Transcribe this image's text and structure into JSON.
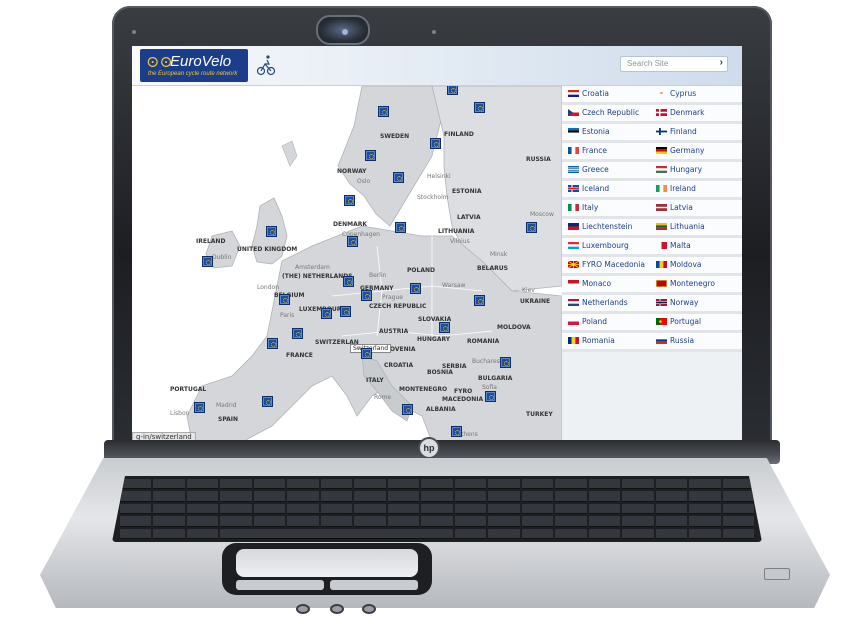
{
  "header": {
    "logo_text": "EuroVelo",
    "logo_tagline": "the European cycle route network",
    "search_placeholder": "Search Site",
    "search_arrow": "›"
  },
  "map": {
    "labels": [
      {
        "text": "SWEDEN"
      },
      {
        "text": "FINLAND"
      },
      {
        "text": "RUSSIA"
      },
      {
        "text": "NORWAY"
      },
      {
        "text": "Oslo"
      },
      {
        "text": "Helsinki"
      },
      {
        "text": "Stockholm"
      },
      {
        "text": "ESTONIA"
      },
      {
        "text": "Moscow"
      },
      {
        "text": "LATVIA"
      },
      {
        "text": "DENMARK"
      },
      {
        "text": "Copenhagen"
      },
      {
        "text": "LITHUANIA"
      },
      {
        "text": "Vilnius"
      },
      {
        "text": "Minsk"
      },
      {
        "text": "IRELAND"
      },
      {
        "text": "UNITED KINGDOM"
      },
      {
        "text": "Dublin"
      },
      {
        "text": "Amsterdam"
      },
      {
        "text": "(THE) NETHERLANDS"
      },
      {
        "text": "Berlin"
      },
      {
        "text": "POLAND"
      },
      {
        "text": "BELARUS"
      },
      {
        "text": "London"
      },
      {
        "text": "BELGIUM"
      },
      {
        "text": "GERMANY"
      },
      {
        "text": "Warsaw"
      },
      {
        "text": "Kiev"
      },
      {
        "text": "UKRAINE"
      },
      {
        "text": "LUXEMBOURG"
      },
      {
        "text": "Prague"
      },
      {
        "text": "CZECH REPUBLIC"
      },
      {
        "text": "Paris"
      },
      {
        "text": "SLOVAKIA"
      },
      {
        "text": "AUSTRIA"
      },
      {
        "text": "MOLDOVA"
      },
      {
        "text": "HUNGARY"
      },
      {
        "text": "SWITZERLAN"
      },
      {
        "text": "SLOVENIA"
      },
      {
        "text": "ROMANIA"
      },
      {
        "text": "FRANCE"
      },
      {
        "text": "CROATIA"
      },
      {
        "text": "Bucharest"
      },
      {
        "text": "BOSNIA"
      },
      {
        "text": "SERBIA"
      },
      {
        "text": "ITALY"
      },
      {
        "text": "BULGARIA"
      },
      {
        "text": "MONTENEGRO"
      },
      {
        "text": "Sofia"
      },
      {
        "text": "FYRO"
      },
      {
        "text": "MACEDONIA"
      },
      {
        "text": "PORTUGAL"
      },
      {
        "text": "Madrid"
      },
      {
        "text": "Rome"
      },
      {
        "text": "ALBANIA"
      },
      {
        "text": "Lisbon"
      },
      {
        "text": "SPAIN"
      },
      {
        "text": "TURKEY"
      },
      {
        "text": "Athens"
      }
    ],
    "tooltip": "Switzerland",
    "status_url": "g-in/switzerland"
  },
  "countries": [
    [
      "Croatia",
      "Cyprus"
    ],
    [
      "Czech Republic",
      "Denmark"
    ],
    [
      "Estonia",
      "Finland"
    ],
    [
      "France",
      "Germany"
    ],
    [
      "Greece",
      "Hungary"
    ],
    [
      "Iceland",
      "Ireland"
    ],
    [
      "Italy",
      "Latvia"
    ],
    [
      "Liechtenstein",
      "Lithuania"
    ],
    [
      "Luxembourg",
      "Malta"
    ],
    [
      "FYRO Macedonia",
      "Moldova"
    ],
    [
      "Monaco",
      "Montenegro"
    ],
    [
      "Netherlands",
      "Norway"
    ],
    [
      "Poland",
      "Portugal"
    ],
    [
      "Romania",
      "Russia"
    ]
  ],
  "colors": {
    "brand_blue": "#1c3e8a",
    "brand_yellow": "#f3c227",
    "link_blue": "#1d3f8f",
    "marker_blue": "#1c4fa0"
  },
  "laptop": {
    "brand_logo": "hp"
  }
}
